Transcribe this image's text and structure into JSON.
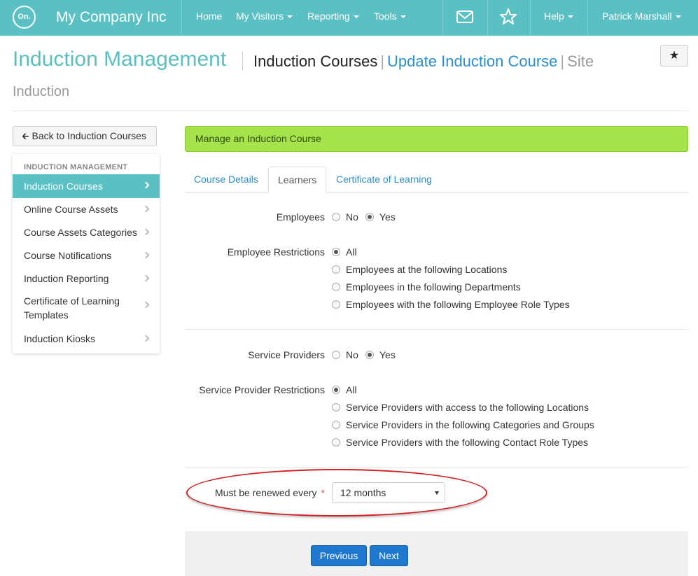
{
  "navbar": {
    "logo_text": "On.",
    "brand": "My Company Inc",
    "items": [
      {
        "label": "Home"
      },
      {
        "label": "My Visitors"
      },
      {
        "label": "Reporting"
      },
      {
        "label": "Tools"
      }
    ],
    "help_label": "Help",
    "user_label": "Patrick Marshall",
    "icons": [
      "mail-icon",
      "star-icon"
    ],
    "bg_color": "#5bc0c3"
  },
  "header": {
    "title": "Induction Management",
    "crumb_current": "Induction Courses",
    "crumb_pipe": "|",
    "crumb_link": "Update Induction Course",
    "crumb_muted_1": "Site",
    "crumb_muted_2": "Induction",
    "star_label": "★"
  },
  "sidebar": {
    "back_label": "Back to Induction Courses",
    "heading": "INDUCTION MANAGEMENT",
    "items": [
      {
        "label": "Induction Courses"
      },
      {
        "label": "Online Course Assets"
      },
      {
        "label": "Course Assets Categories"
      },
      {
        "label": "Course Notifications"
      },
      {
        "label": "Induction Reporting"
      },
      {
        "label": "Certificate of Learning Templates"
      },
      {
        "label": "Induction Kiosks"
      }
    ]
  },
  "main": {
    "banner": "Manage an Induction Course",
    "tabs": [
      {
        "label": "Course Details"
      },
      {
        "label": "Learners"
      },
      {
        "label": "Certificate of Learning"
      }
    ],
    "employees": {
      "label": "Employees",
      "no_label": "No",
      "yes_label": "Yes",
      "selected": "Yes"
    },
    "employee_restrictions": {
      "label": "Employee Restrictions",
      "options": [
        "All",
        "Employees at the following Locations",
        "Employees in the following Departments",
        "Employees with the following Employee Role Types"
      ],
      "selected": "All"
    },
    "service_providers": {
      "label": "Service Providers",
      "no_label": "No",
      "yes_label": "Yes",
      "selected": "Yes"
    },
    "service_provider_restrictions": {
      "label": "Service Provider Restrictions",
      "options": [
        "All",
        "Service Providers with access to the following Locations",
        "Service Providers in the following Categories and Groups",
        "Service Providers with the following Contact Role Types"
      ],
      "selected": "All"
    },
    "renewal": {
      "label": "Must be renewed every",
      "required_mark": "*",
      "value": "12 months"
    },
    "buttons": {
      "previous": "Previous",
      "next": "Next"
    },
    "accent_color": "#a6e34a",
    "primary_color": "#1f78cf",
    "annotation_color": "#d42020"
  }
}
